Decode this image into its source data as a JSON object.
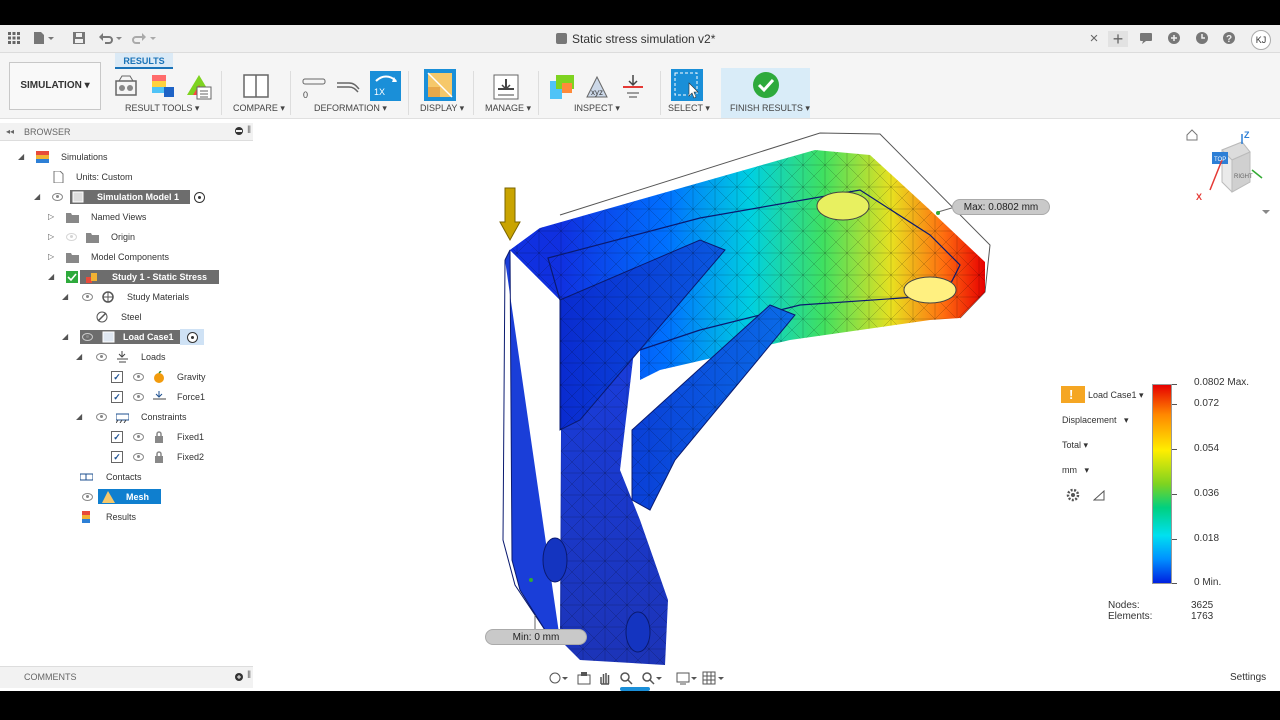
{
  "titlebar": {
    "document_title": "Static stress simulation v2*",
    "user_initials": "KJ",
    "close_glyph": "×",
    "plus_glyph": "+"
  },
  "toolbar": {
    "workspace_label": "SIMULATION ▾",
    "results_tab": "RESULTS",
    "groups": {
      "result_tools": "RESULT TOOLS ▾",
      "compare": "COMPARE ▾",
      "deformation": "DEFORMATION ▾",
      "display": "DISPLAY ▾",
      "manage": "MANAGE ▾",
      "inspect": "INSPECT ▾",
      "select": "SELECT ▾",
      "finish": "FINISH RESULTS ▾"
    },
    "deformation_zero": "0",
    "deformation_scale": "1X"
  },
  "browser": {
    "title": "BROWSER",
    "items": {
      "simulations": "Simulations",
      "units": "Units: Custom",
      "model": "Simulation Model 1",
      "named_views": "Named Views",
      "origin": "Origin",
      "model_components": "Model Components",
      "study": "Study 1 - Static Stress",
      "study_materials": "Study Materials",
      "steel": "Steel",
      "load_case": "Load Case1",
      "loads": "Loads",
      "gravity": "Gravity",
      "force": "Force1",
      "constraints": "Constraints",
      "fixed1": "Fixed1",
      "fixed2": "Fixed2",
      "contacts": "Contacts",
      "mesh": "Mesh",
      "results": "Results"
    }
  },
  "comments": {
    "title": "COMMENTS"
  },
  "viewport": {
    "max_label": "Max: 0.0802 mm",
    "min_label": "Min: 0 mm",
    "viewcube": {
      "top": "TOP",
      "right": "RIGHT",
      "axis_z": "Z",
      "axis_x": "X"
    }
  },
  "legend": {
    "warning": "!",
    "load_case": "Load Case1",
    "result_type": "Displacement",
    "component": "Total",
    "unit": "mm",
    "ticks": [
      "0.0802 Max.",
      "0.072",
      "0.054",
      "0.036",
      "0.018",
      "0 Min."
    ],
    "nodes_label": "Nodes:",
    "nodes_value": "3625",
    "elements_label": "Elements:",
    "elements_value": "1763"
  },
  "statusbar": {
    "settings": "Settings"
  },
  "colors": {
    "accent": "#0f7fcf",
    "finish_green": "#2eaa3c",
    "max_red": "#e60000",
    "min_blue": "#0020e0"
  }
}
